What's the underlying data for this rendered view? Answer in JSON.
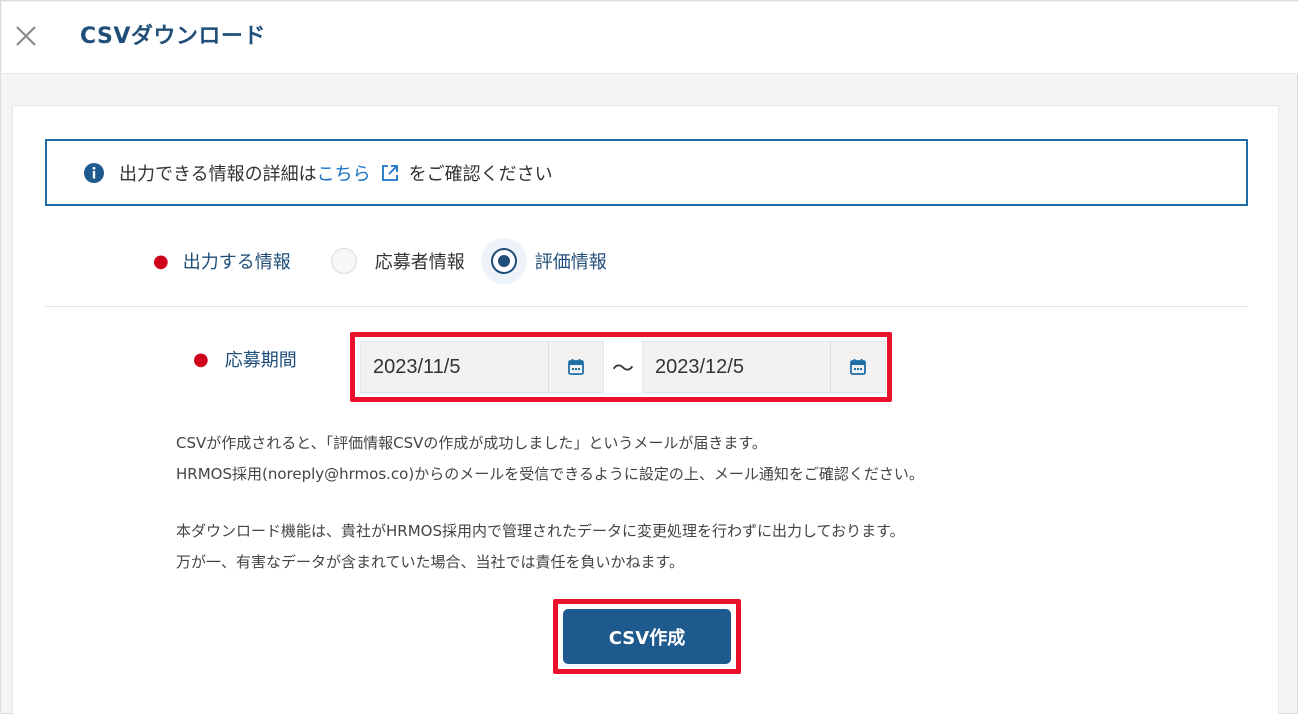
{
  "header": {
    "title": "CSVダウンロード",
    "close_icon": "close-icon"
  },
  "info": {
    "icon": "info-icon",
    "text_before": "出力できる情報の詳細は",
    "link_text": "こちら",
    "link_icon": "external-link-icon",
    "text_after": "をご確認ください"
  },
  "output": {
    "label": "出力する情報",
    "options": [
      {
        "label": "応募者情報",
        "selected": false
      },
      {
        "label": "評価情報",
        "selected": true
      }
    ]
  },
  "period": {
    "label": "応募期間",
    "start": "2023/11/5",
    "separator": "〜",
    "end": "2023/12/5",
    "calendar_icon": "calendar-icon"
  },
  "notes": {
    "line1": "CSVが作成されると、「評価情報CSVの作成が成功しました」というメールが届きます。",
    "line2": "HRMOS採用(noreply@hrmos.co)からのメールを受信できるように設定の上、メール通知をご確認ください。",
    "line3": "本ダウンロード機能は、貴社がHRMOS採用内で管理されたデータに変更処理を行わずに出力しております。",
    "line4": "万が一、有害なデータが含まれていた場合、当社では責任を負いかねます。"
  },
  "action": {
    "create_label": "CSV作成"
  },
  "colors": {
    "primary": "#1f4e79",
    "button": "#1f5a8f",
    "link": "#1a73c6",
    "required": "#d0021b",
    "highlight": "#e8102a"
  }
}
